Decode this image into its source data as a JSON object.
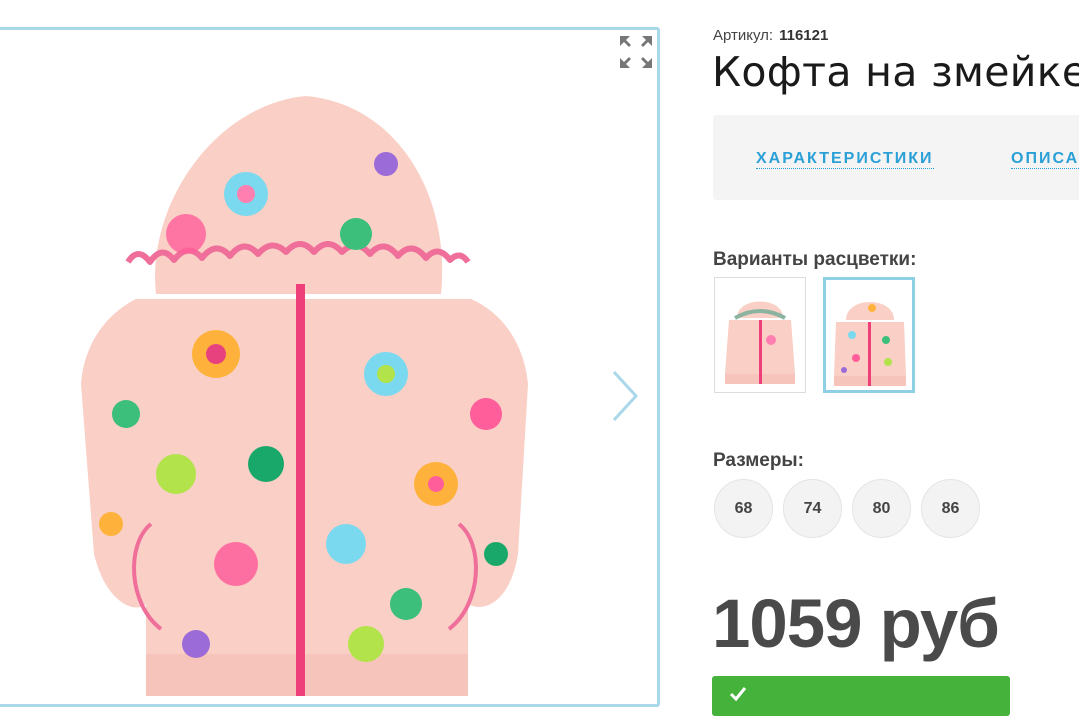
{
  "product": {
    "sku_label": "Артикул:",
    "sku_value": "116121",
    "title": "Кофта на змейке"
  },
  "gallery": {
    "main_image": "pink floral hoodie with zipper",
    "expand_icon": "expand-icon",
    "next_icon": "chevron-right-icon"
  },
  "tabs": [
    {
      "label": "ХАРАКТЕРИСТИКИ"
    },
    {
      "label": "ОПИСАНИЕ"
    }
  ],
  "colors": {
    "label": "Варианты расцветки:",
    "selected_index": 1,
    "options": [
      {
        "image": "pink hoodie with small print"
      },
      {
        "image": "pink hoodie with floral print"
      }
    ]
  },
  "sizes": {
    "label": "Размеры:",
    "options": [
      "68",
      "74",
      "80",
      "86"
    ]
  },
  "price": {
    "text": "1059 руб"
  },
  "buy": {
    "icon": "check-icon"
  },
  "colors_palette": {
    "accent_blue": "#2aa0d6",
    "frame_blue": "#a9d8ea",
    "buy_green": "#44b23b",
    "hoodie_pink": "#f9cfc6",
    "zipper_pink": "#ef3f7a"
  }
}
